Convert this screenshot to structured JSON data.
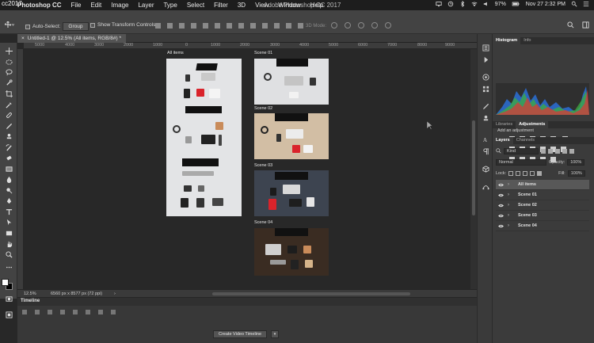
{
  "menubar": {
    "corner_label": "cc2017",
    "app_name": "Photoshop CC",
    "items": [
      "File",
      "Edit",
      "Image",
      "Layer",
      "Type",
      "Select",
      "Filter",
      "3D",
      "View",
      "Window",
      "Help"
    ],
    "window_title": "Adobe Photoshop CC 2017",
    "battery": "97%",
    "datetime": "Nov 27  2:32 PM"
  },
  "options": {
    "auto_select_label": "Auto-Select:",
    "auto_select_value": "Group",
    "transform_label": "Show Transform Controls",
    "mode_3d_label": "3D Mode:"
  },
  "document": {
    "tab_title": "Untitled-1 @ 12.5% (All items, RGB/8#) *",
    "tab_close": "×"
  },
  "rulers": {
    "h_ticks": [
      "5000",
      "4000",
      "3000",
      "2000",
      "1000",
      "0",
      "1000",
      "2000",
      "3000",
      "4000",
      "5000",
      "6000",
      "7000",
      "8000",
      "9000",
      "10000",
      "11000"
    ]
  },
  "artboards": [
    {
      "label": "All items"
    },
    {
      "label": "Scene 01"
    },
    {
      "label": "Scene 02"
    },
    {
      "label": "Scene 03"
    },
    {
      "label": "Scene 04"
    }
  ],
  "status": {
    "zoom": "12.5%",
    "doc_info": "6560 px x 8577 px (72 ppi)",
    "arrow": "›"
  },
  "timeline": {
    "title": "Timeline",
    "create_button": "Create Video Timeline",
    "create_dropdown": "▾"
  },
  "panels": {
    "top_tabs": [
      "Histogram",
      "Info"
    ],
    "mid_tabs": [
      "Libraries",
      "Adjustments"
    ],
    "adjustments_title": "Add an adjustment",
    "layer_tabs": [
      "Layers",
      "Channels"
    ],
    "kind_label": "Kind",
    "blend_mode": "Normal",
    "opacity_label": "Opacity:",
    "opacity_value": "100%",
    "lock_label": "Lock:",
    "fill_label": "Fill:",
    "fill_value": "100%",
    "layers": [
      {
        "name": "All items",
        "selected": true
      },
      {
        "name": "Scene 01",
        "selected": false
      },
      {
        "name": "Scene 02",
        "selected": false
      },
      {
        "name": "Scene 03",
        "selected": false
      },
      {
        "name": "Scene 04",
        "selected": false
      }
    ]
  },
  "colors": {
    "foreground": "#ffffff",
    "background": "#000000",
    "accent_red": "#d9232b"
  }
}
